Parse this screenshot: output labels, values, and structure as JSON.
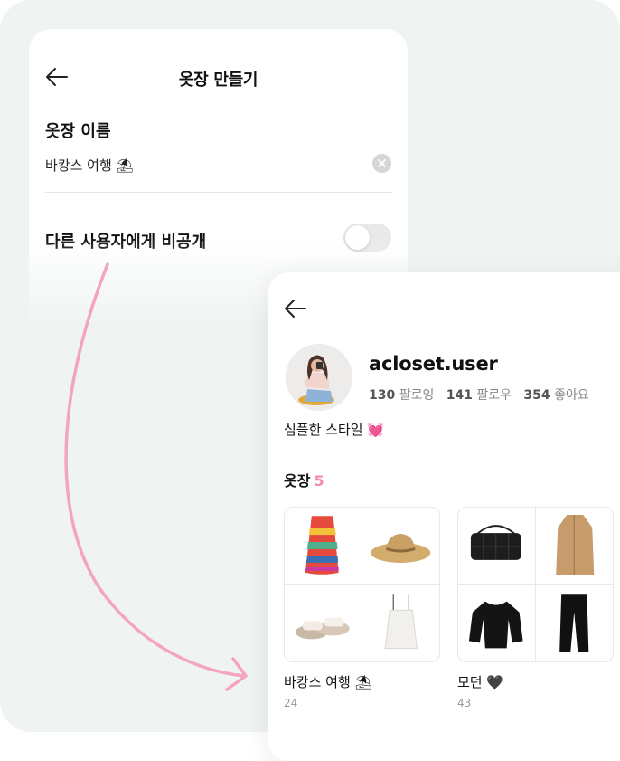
{
  "create_closet": {
    "title": "옷장 만들기",
    "name_label": "옷장 이름",
    "name_value": "바캉스 여행 ⛱",
    "private_label": "다른 사용자에게 비공개",
    "private_enabled": false
  },
  "profile": {
    "username": "acloset.user",
    "stats": [
      {
        "value": "130",
        "label": "팔로잉"
      },
      {
        "value": "141",
        "label": "팔로우"
      },
      {
        "value": "354",
        "label": "좋아요"
      }
    ],
    "bio": "심플한 스타일 💓",
    "closets_label": "옷장",
    "closets_count": "5",
    "closets": [
      {
        "name": "바캉스 여행 ⛱",
        "count": "24",
        "items": [
          "striped-skirt-icon",
          "straw-hat-icon",
          "sandals-icon",
          "white-crop-top-icon"
        ]
      },
      {
        "name": "모던 🖤",
        "count": "43",
        "items": [
          "black-quilted-bag-icon",
          "trench-coat-icon",
          "black-blouse-icon",
          "leather-pants-icon"
        ]
      }
    ]
  },
  "colors": {
    "accent": "#f28ab0",
    "background": "#eff4f2"
  }
}
